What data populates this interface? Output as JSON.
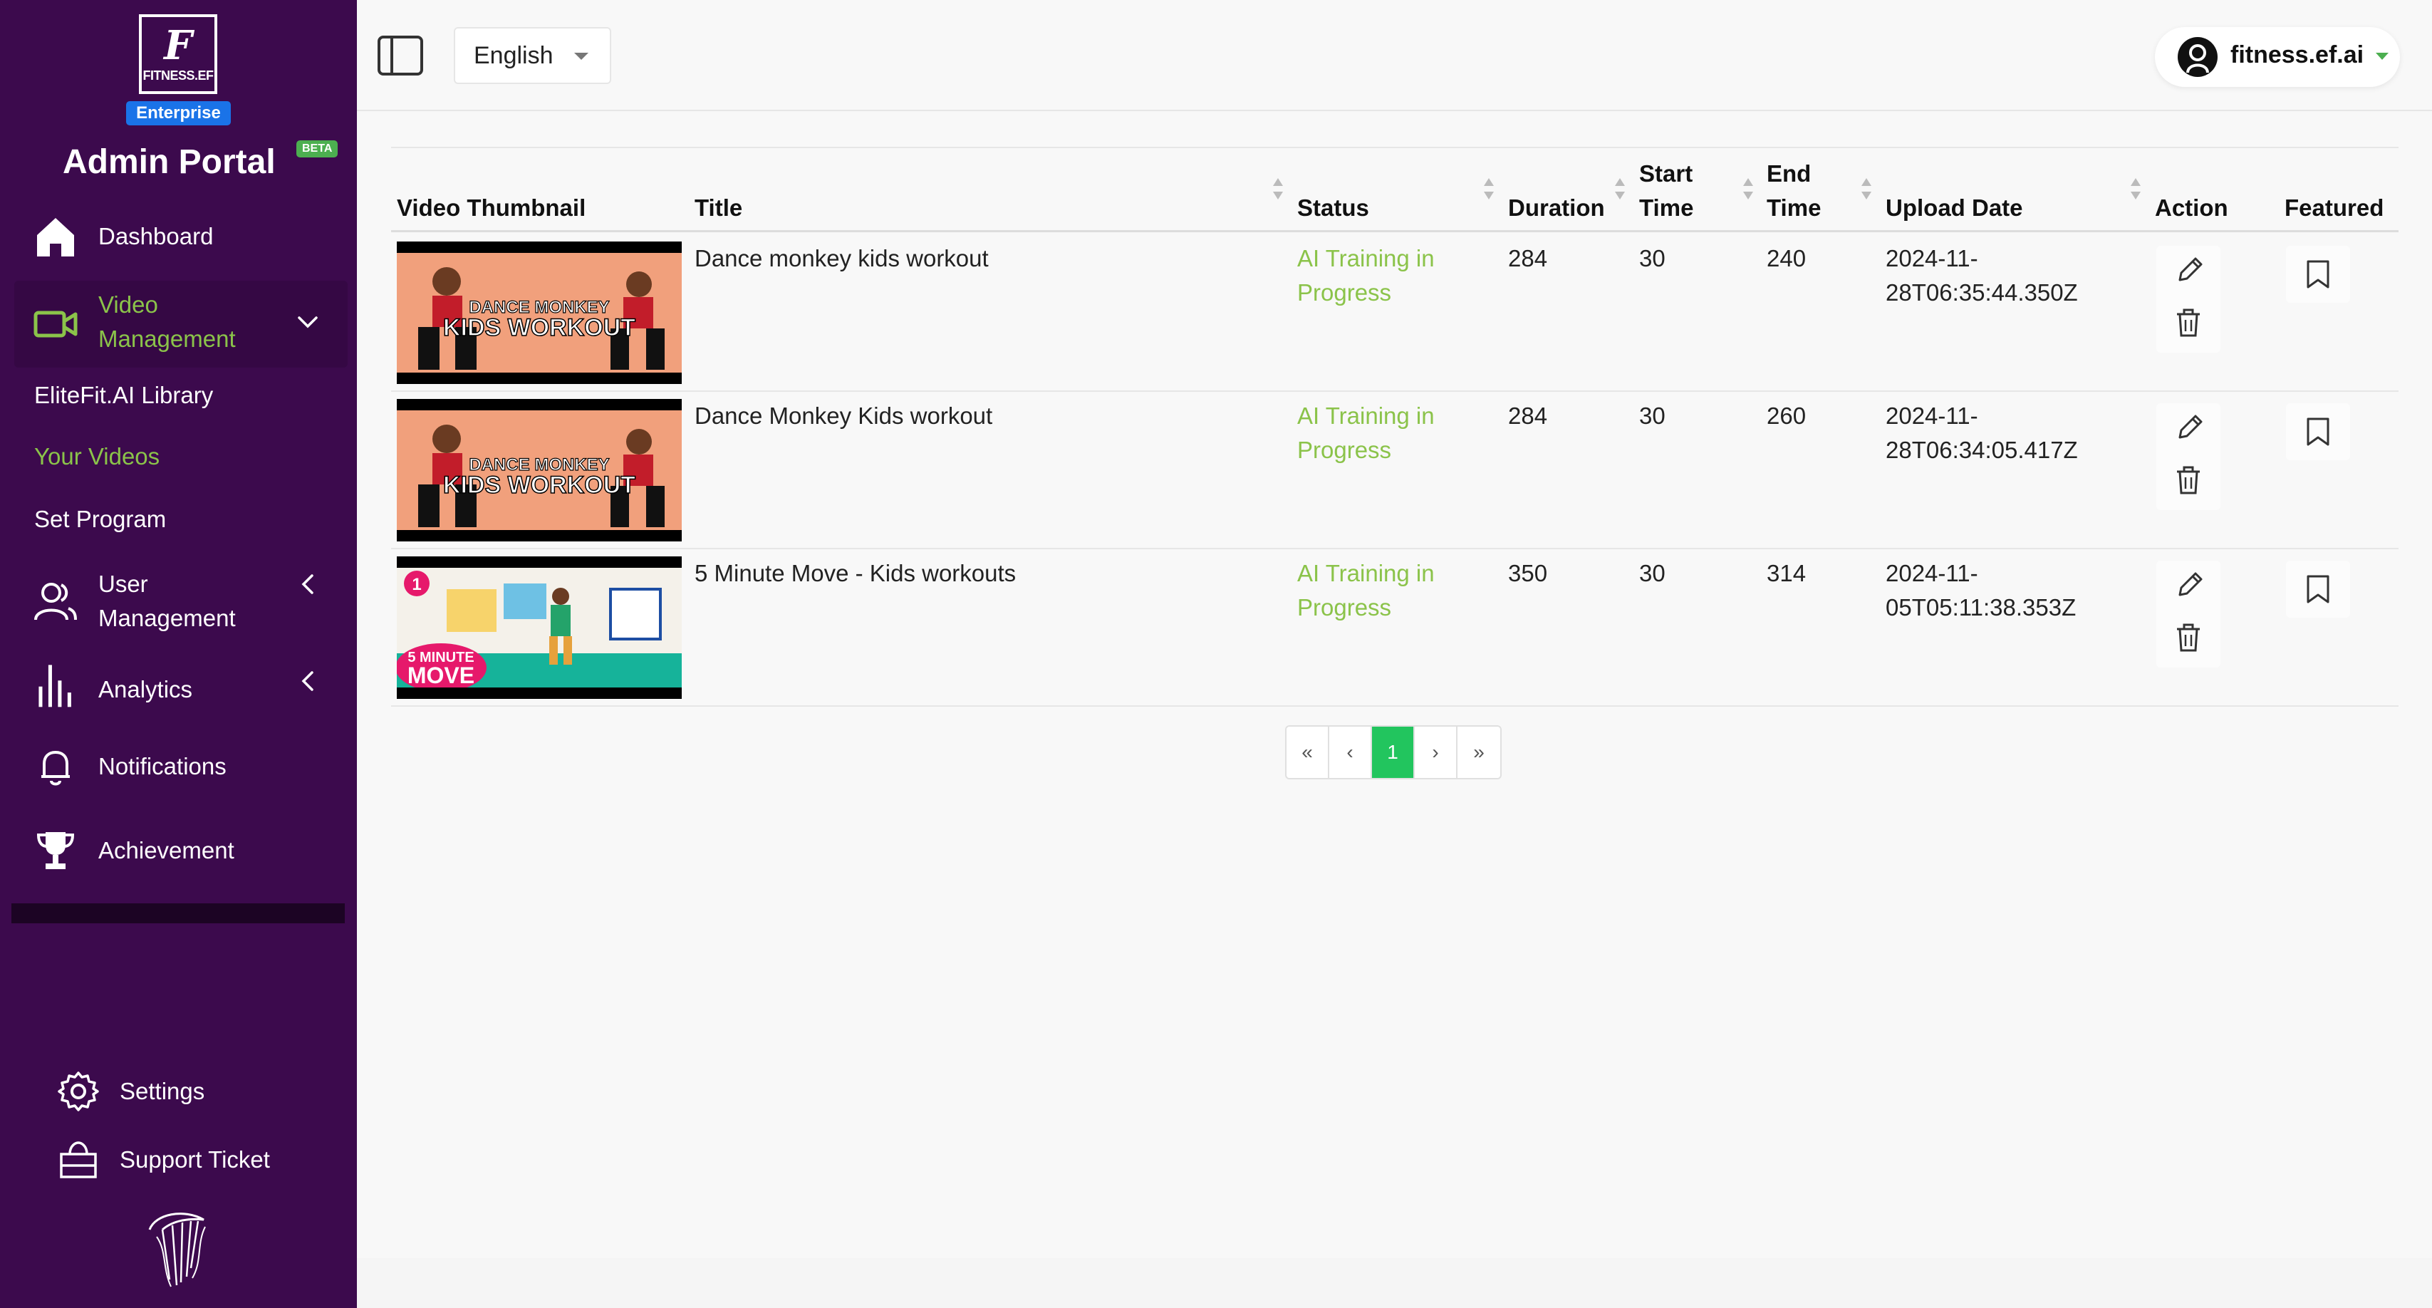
{
  "brand": {
    "logo_letter": "F",
    "logo_text": "FITNESS.EF",
    "edition_badge": "Enterprise",
    "portal_title": "Admin Portal",
    "beta_label": "BETA"
  },
  "sidebar": {
    "items": [
      {
        "label": "Dashboard",
        "icon": "home-icon"
      },
      {
        "label": "Video Management",
        "icon": "video-camera-icon",
        "expanded": true
      },
      {
        "label": "User Management",
        "icon": "users-icon"
      },
      {
        "label": "Analytics",
        "icon": "bar-chart-icon"
      },
      {
        "label": "Notifications",
        "icon": "bell-icon"
      },
      {
        "label": "Achievement",
        "icon": "trophy-icon"
      }
    ],
    "video_line1": "Video",
    "video_line2": "Management",
    "user_line1": "User",
    "user_line2": "Management",
    "subitems": [
      {
        "label": "EliteFit.AI Library"
      },
      {
        "label": "Your Videos",
        "active": true
      },
      {
        "label": "Set Program"
      }
    ],
    "bottom": [
      {
        "label": "Settings",
        "icon": "gear-icon"
      },
      {
        "label": "Support Ticket",
        "icon": "ticket-icon"
      }
    ],
    "colors": {
      "background": "#3c0a4d",
      "active": "#8bc34a"
    }
  },
  "header": {
    "language": "English",
    "account_name": "fitness.ef.ai"
  },
  "table": {
    "columns": {
      "thumbnail": "Video Thumbnail",
      "title": "Title",
      "status": "Status",
      "duration": "Duration",
      "start_time_1": "Start",
      "start_time_2": "Time",
      "end_time_1": "End",
      "end_time_2": "Time",
      "upload_date": "Upload Date",
      "action": "Action",
      "featured": "Featured"
    },
    "rows": [
      {
        "thumb_caption_1": "DANCE MONKEY",
        "thumb_caption_2": "KIDS WORKOUT",
        "title": "Dance monkey kids workout",
        "status_1": "AI Training in",
        "status_2": "Progress",
        "duration": "284",
        "start_time": "30",
        "end_time": "240",
        "upload_1": "2024-11-",
        "upload_2": "28T06:35:44.350Z"
      },
      {
        "thumb_caption_1": "DANCE MONKEY",
        "thumb_caption_2": "KIDS WORKOUT",
        "title": "Dance Monkey Kids workout",
        "status_1": "AI Training in",
        "status_2": "Progress",
        "duration": "284",
        "start_time": "30",
        "end_time": "260",
        "upload_1": "2024-11-",
        "upload_2": "28T06:34:05.417Z"
      },
      {
        "thumb_caption_1": "5 MINUTE",
        "thumb_caption_2": "MOVE",
        "thumb_number": "1",
        "title": "5 Minute Move - Kids workouts",
        "status_1": "AI Training in",
        "status_2": "Progress",
        "duration": "350",
        "start_time": "30",
        "end_time": "314",
        "upload_1": "2024-11-",
        "upload_2": "05T05:11:38.353Z"
      }
    ],
    "status_color": "#8bc34a"
  },
  "pagination": {
    "first": "«",
    "prev": "‹",
    "current": "1",
    "next": "›",
    "last": "»",
    "accent": "#22c55e"
  }
}
